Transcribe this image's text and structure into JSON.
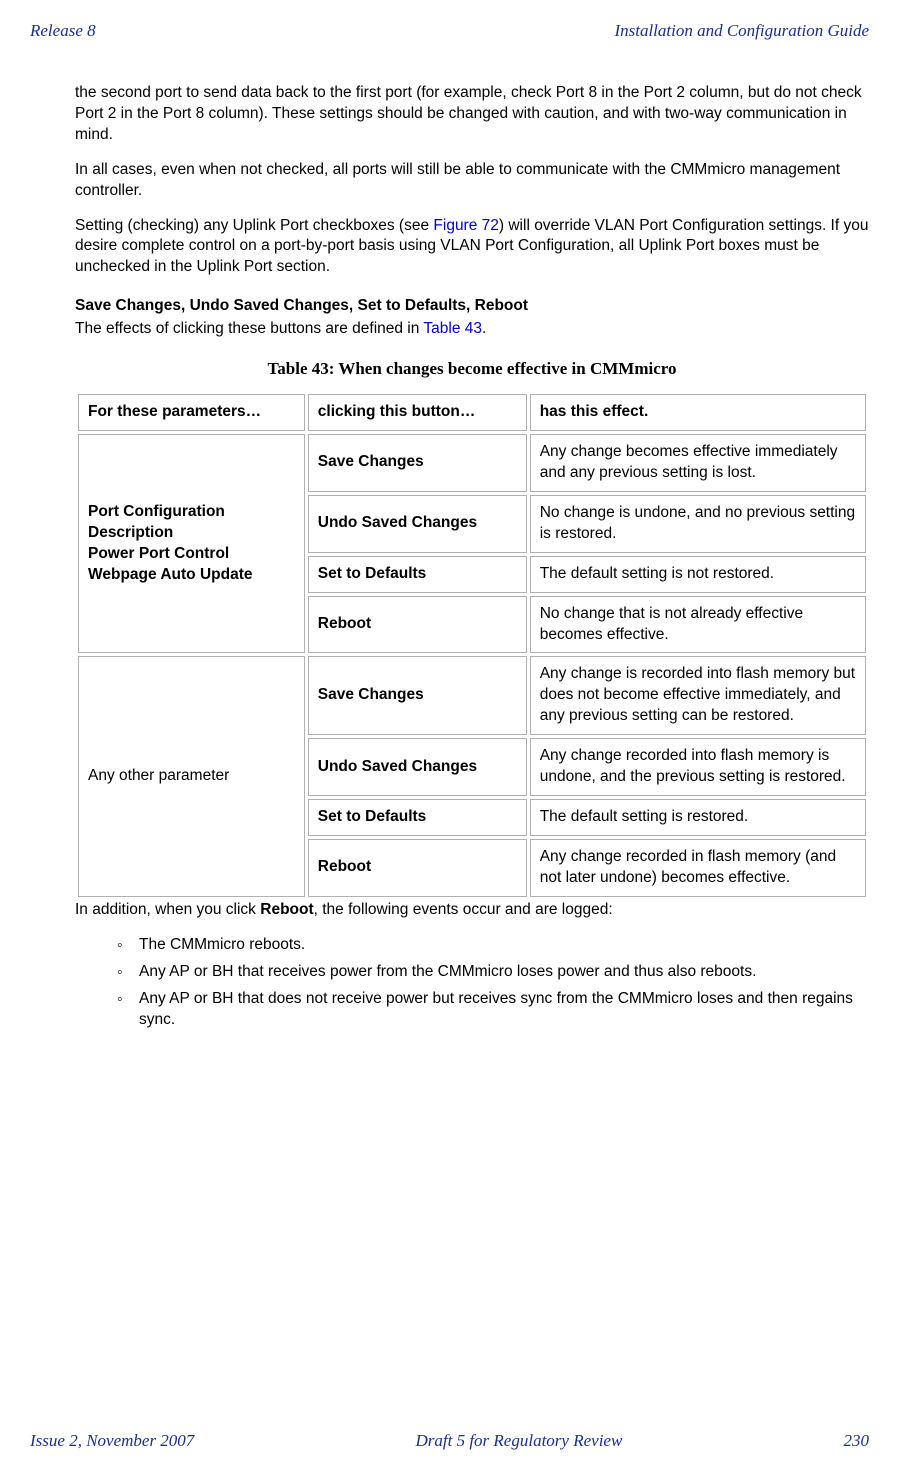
{
  "header": {
    "left": "Release 8",
    "right": "Installation and Configuration Guide"
  },
  "body": {
    "p1": "the second port to send data back to the first port (for example, check Port 8 in the Port 2 column, but do not check Port 2 in the Port 8 column). These settings should be changed with caution, and with two-way communication in mind.",
    "p2": "In all  cases, even when not checked, all ports will still be able to communicate with the CMMmicro management controller.",
    "p3_a": "Setting (checking) any Uplink Port checkboxes (see ",
    "p3_link": "Figure 72",
    "p3_b": ") will override VLAN Port Configuration settings.  If you desire complete control on a port-by-port basis using VLAN Port Configuration, all Uplink Port boxes must be unchecked in the Uplink Port section.",
    "h1": "Save Changes, Undo Saved Changes, Set to Defaults, Reboot",
    "p4_a": "The effects of clicking these buttons are defined in ",
    "p4_link": "Table 43",
    "p4_b": ".",
    "table_caption": "Table 43: When changes become effective in CMMmicro",
    "table": {
      "head": {
        "c1": "For these parameters…",
        "c2": "clicking this button…",
        "c3": "has this effect."
      },
      "group1": {
        "label_l1": "Port Configuration",
        "label_l2": "Description",
        "label_l3": "Power Port Control",
        "label_l4": "Webpage Auto Update",
        "r1": {
          "button": "Save Changes",
          "effect": "Any change becomes effective immediately and any previous setting is lost."
        },
        "r2": {
          "button": "Undo Saved Changes",
          "effect": "No change is undone, and no previous setting is restored."
        },
        "r3": {
          "button": "Set to Defaults",
          "effect": "The default setting is not restored."
        },
        "r4": {
          "button": "Reboot",
          "effect": "No change that is not already effective becomes effective."
        }
      },
      "group2": {
        "label": "Any other parameter",
        "r1": {
          "button": "Save Changes",
          "effect": "Any change is recorded into flash memory but does not become effective immediately, and any previous setting can be restored."
        },
        "r2": {
          "button": "Undo Saved Changes",
          "effect": "Any change recorded into flash memory is undone, and the previous setting is restored."
        },
        "r3": {
          "button": "Set to Defaults",
          "effect": "The default setting is restored."
        },
        "r4": {
          "button": "Reboot",
          "effect": "Any change recorded in flash memory (and not later undone) becomes effective."
        }
      }
    },
    "p5_a": "In addition, when you click ",
    "p5_bold": "Reboot",
    "p5_b": ", the following events occur and are logged:",
    "bullets": {
      "b1": "The CMMmicro reboots.",
      "b2": "Any AP or BH that receives power from the CMMmicro loses power and thus also reboots.",
      "b3": "Any AP or BH that does not receive power but receives sync from the CMMmicro loses and then regains sync."
    }
  },
  "footer": {
    "left": "Issue 2, November 2007",
    "center": "Draft 5 for Regulatory Review",
    "right": "230"
  }
}
